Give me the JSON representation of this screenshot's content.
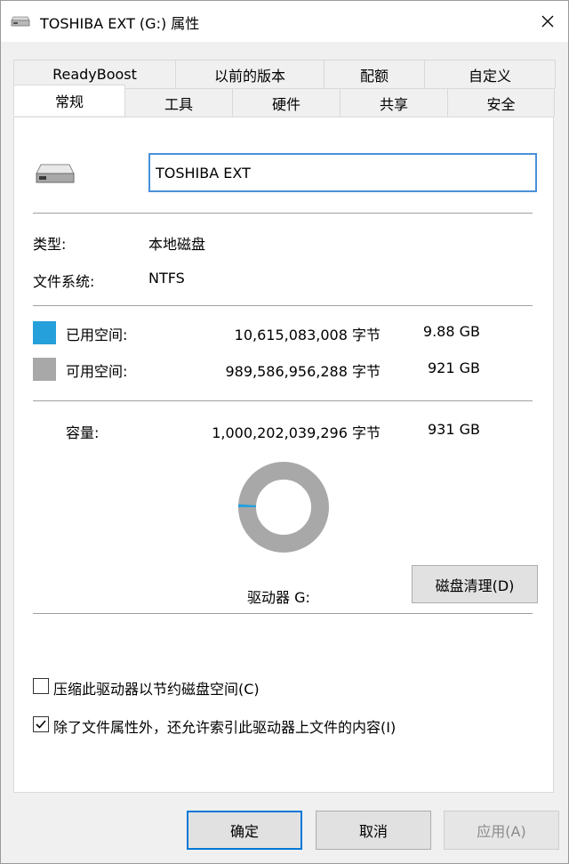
{
  "window": {
    "title": "TOSHIBA EXT (G:) 属性",
    "close_glyph": "✕"
  },
  "tabs_top": [
    "ReadyBoost",
    "以前的版本",
    "配额",
    "自定义"
  ],
  "tabs_bottom": [
    "常规",
    "工具",
    "硬件",
    "共享",
    "安全"
  ],
  "general": {
    "volume_name": "TOSHIBA EXT",
    "type_label": "类型:",
    "type_value": "本地磁盘",
    "fs_label": "文件系统:",
    "fs_value": "NTFS",
    "used": {
      "label": "已用空间:",
      "bytes": "10,615,083,008 字节",
      "size": "9.88 GB",
      "color": "#26a0da"
    },
    "free": {
      "label": "可用空间:",
      "bytes": "989,586,956,288 字节",
      "size": "921 GB",
      "color": "#a8a8a8"
    },
    "capacity": {
      "label": "容量:",
      "bytes": "1,000,202,039,296 字节",
      "size": "931 GB"
    },
    "used_fraction": 0.0106,
    "drive_label": "驱动器 G:",
    "cleanup_button": "磁盘清理(D)",
    "compress": {
      "label": "压缩此驱动器以节约磁盘空间(C)",
      "checked": false
    },
    "index": {
      "label": "除了文件属性外，还允许索引此驱动器上文件的内容(I)",
      "checked": true
    }
  },
  "buttons": {
    "ok": "确定",
    "cancel": "取消",
    "apply": "应用(A)"
  }
}
